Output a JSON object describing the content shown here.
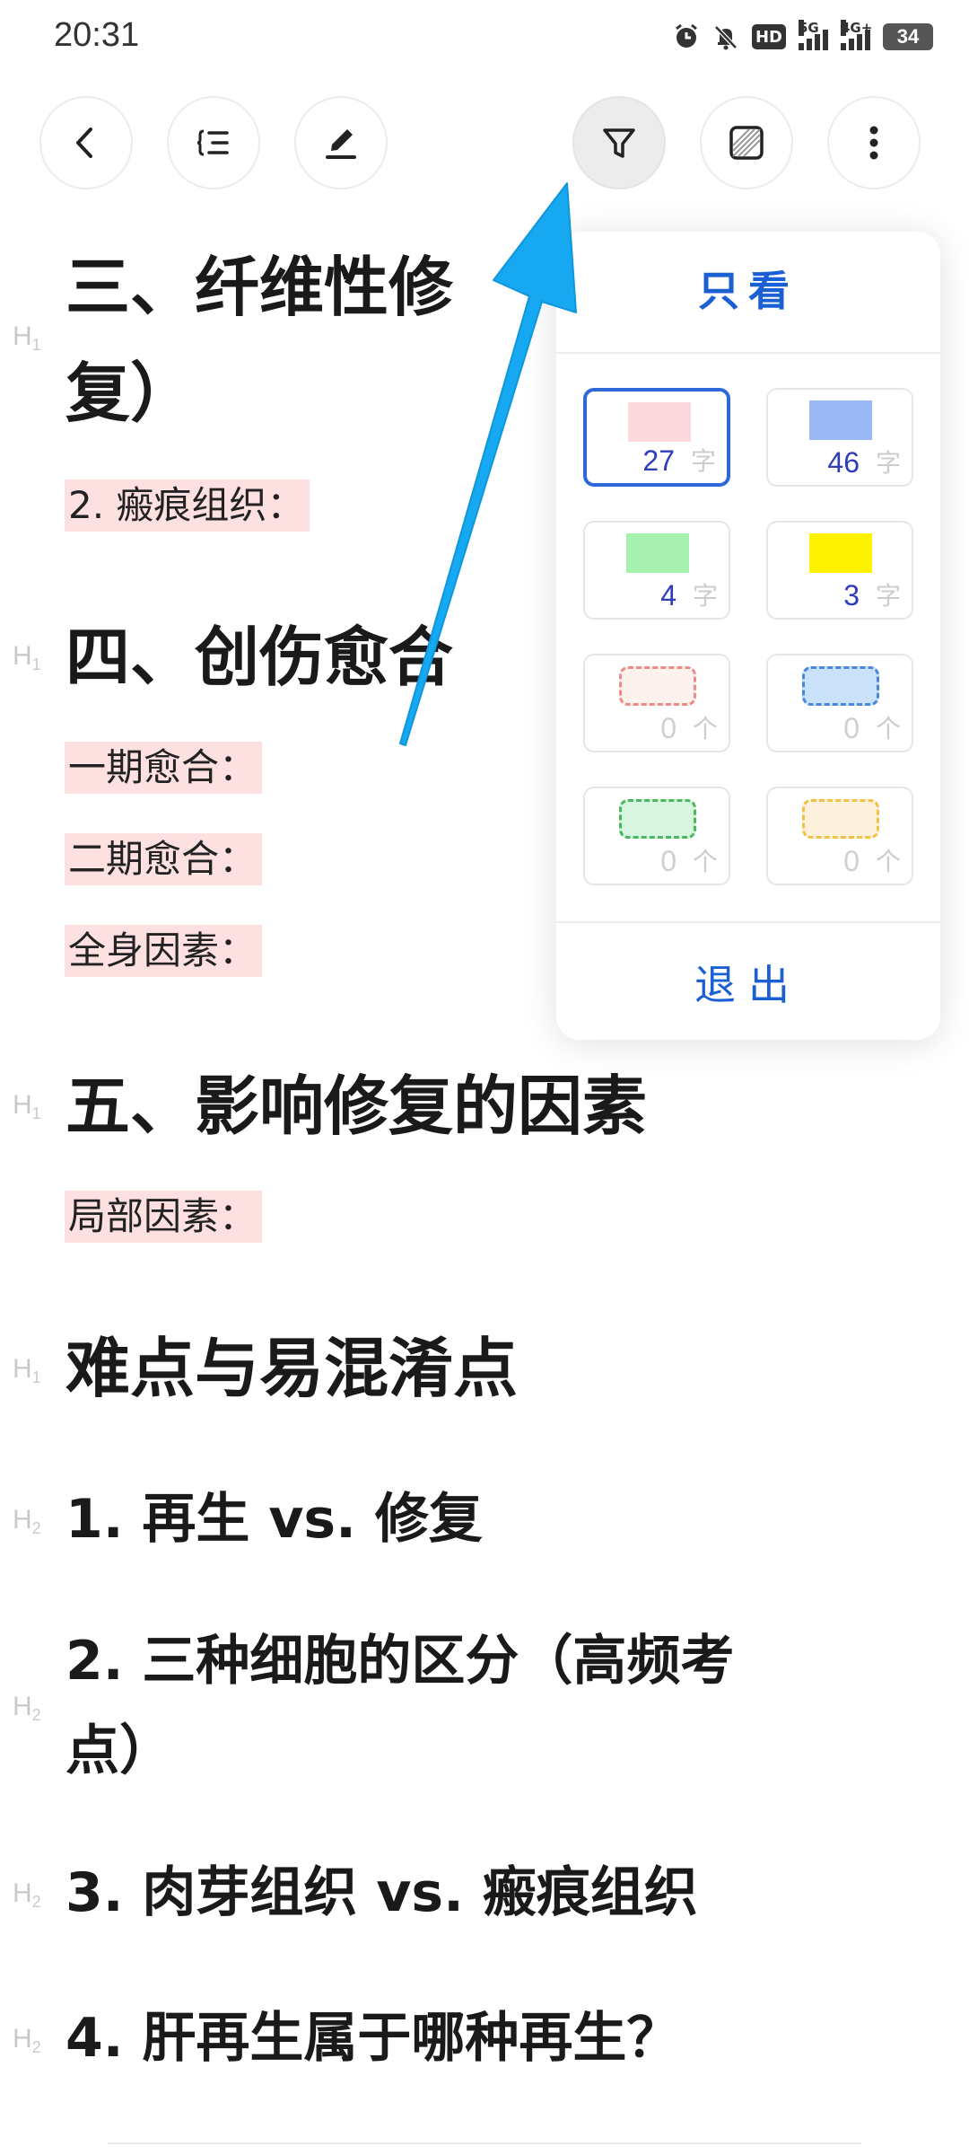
{
  "status_bar": {
    "time": "20:31",
    "hd_label": "HD",
    "net1": "5G",
    "net2": "4G+",
    "battery": "34"
  },
  "toolbar": {
    "icons": [
      "back-icon",
      "outline-icon",
      "edit-icon",
      "filter-icon",
      "highlight-style-icon",
      "more-icon"
    ]
  },
  "document": {
    "heading_marks": {
      "h1": "H",
      "h1_sub": "1",
      "h2": "H",
      "h2_sub": "2"
    },
    "section3": {
      "line1": "三、纤维性修",
      "line2": "复）",
      "item": "2. 瘢痕组织："
    },
    "section4": {
      "title": "四、创伤愈合",
      "items": [
        "一期愈合：",
        "二期愈合：",
        "全身因素："
      ]
    },
    "section5": {
      "title": "五、影响修复的因素",
      "item": "局部因素："
    },
    "section6": {
      "title": "难点与易混淆点"
    },
    "h2_items": [
      "1.  再生 vs. 修复",
      "2.  三种细胞的区分（高频考",
      "点）",
      "3.  肉芽组织 vs. 瘢痕组织",
      "4.  肝再生属于哪种再生？"
    ]
  },
  "filter_popup": {
    "title": "只看",
    "exit": "退出",
    "highlight_cards": [
      {
        "color": "#fbd9dc",
        "count": "27",
        "unit": "字",
        "selected": true
      },
      {
        "color": "#9ab8f6",
        "count": "46",
        "unit": "字",
        "selected": false
      },
      {
        "color": "#a6f1b0",
        "count": "4",
        "unit": "字",
        "selected": false
      },
      {
        "color": "#fff200",
        "count": "3",
        "unit": "字",
        "selected": false
      }
    ],
    "box_cards": [
      {
        "color": "#ef8a8a",
        "fill": "#fdf2ee",
        "count": "0",
        "unit": "个"
      },
      {
        "color": "#4a86e0",
        "fill": "#c9e2fa",
        "count": "0",
        "unit": "个"
      },
      {
        "color": "#49b860",
        "fill": "#d8f6df",
        "count": "0",
        "unit": "个"
      },
      {
        "color": "#f2c246",
        "fill": "#fdf1dd",
        "count": "0",
        "unit": "个"
      }
    ]
  },
  "colors": {
    "accent": "#1a5fd4",
    "arrow": "#17a8f2",
    "highlight_pink": "#fde1e1"
  }
}
